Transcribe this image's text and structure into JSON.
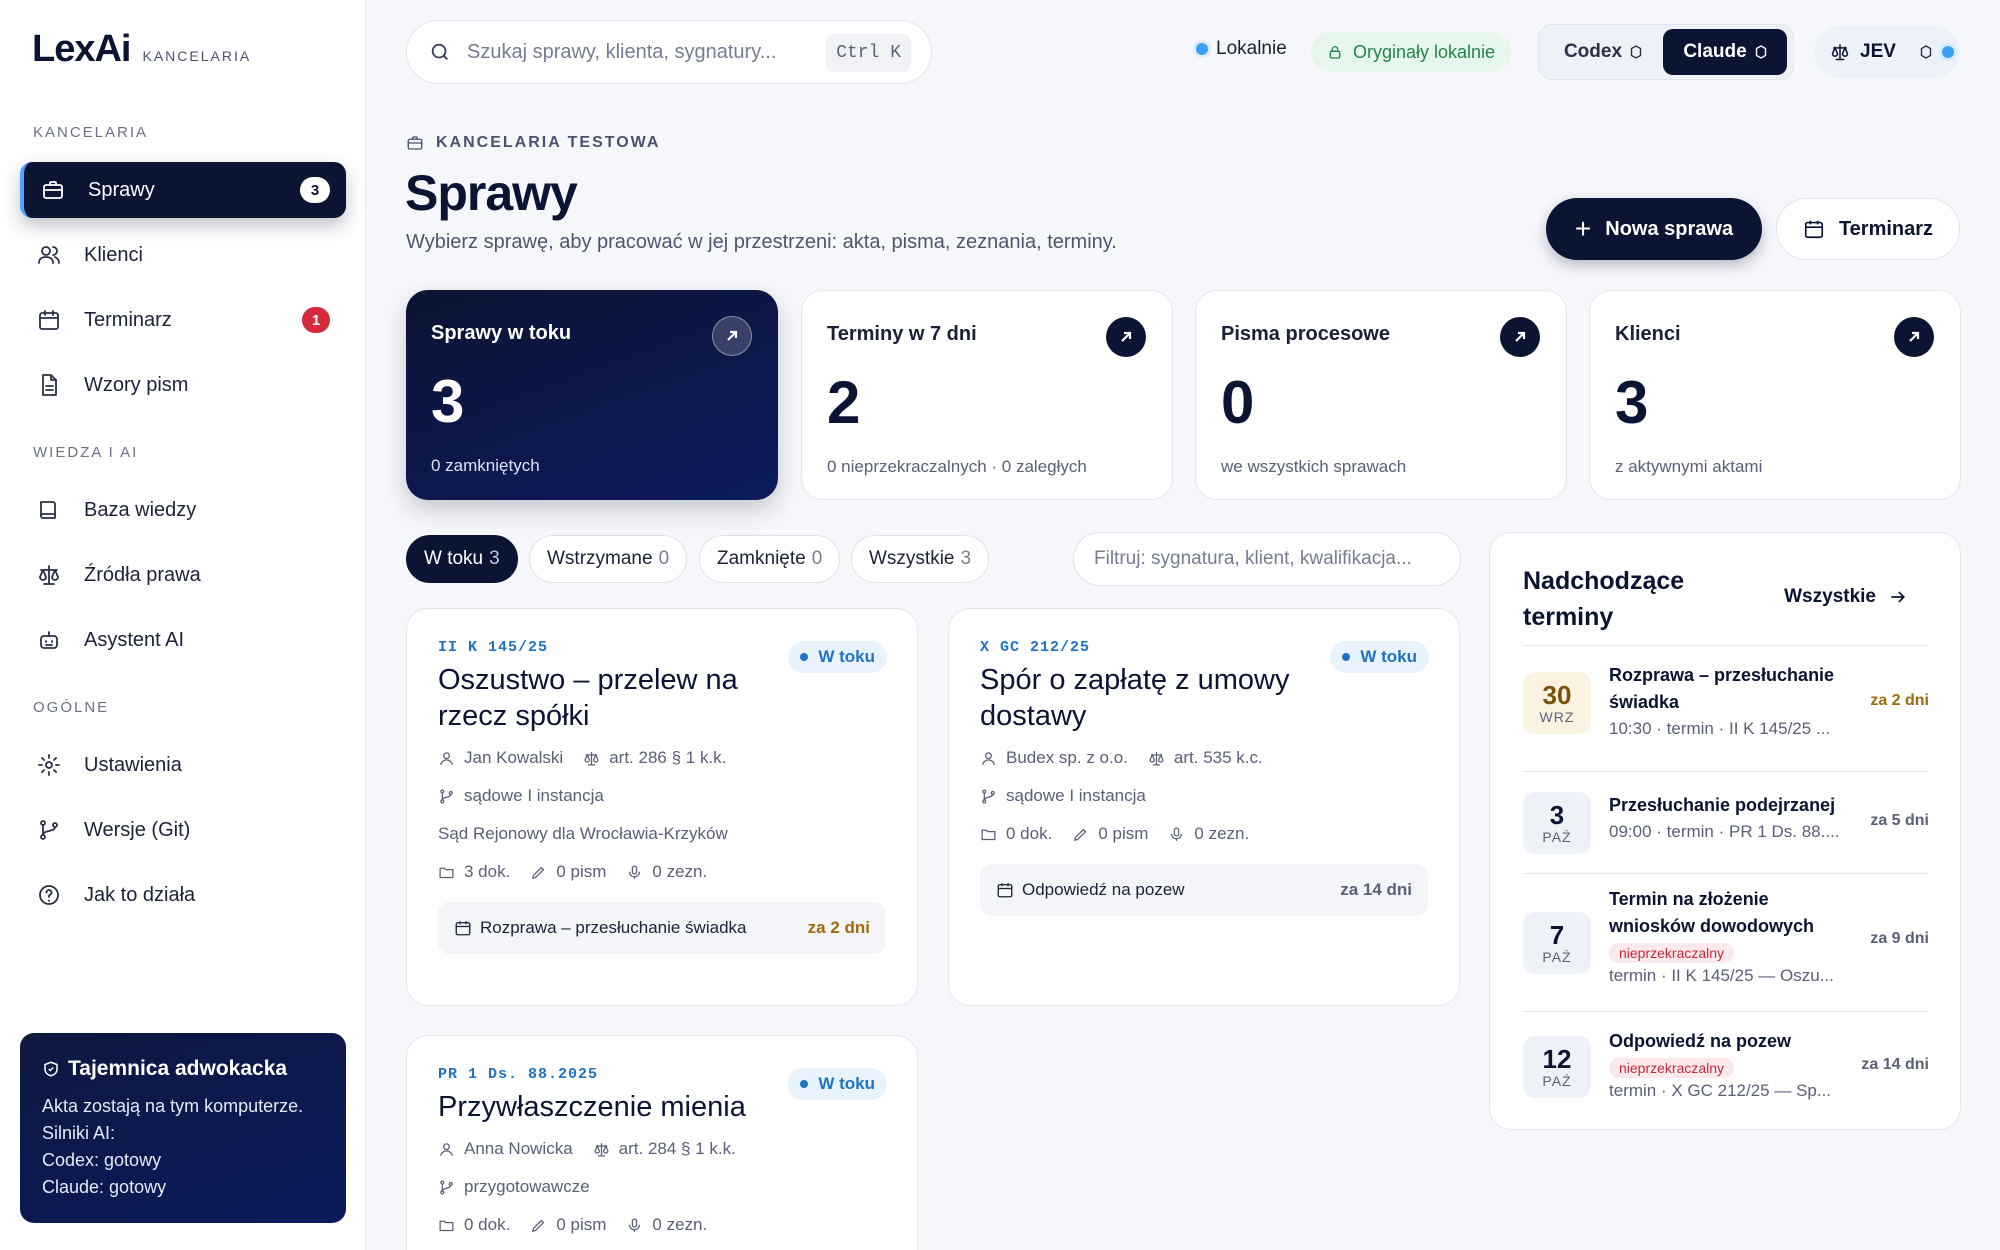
{
  "brand": {
    "name": "LexAi",
    "subtitle": "KANCELARIA"
  },
  "sidebar": {
    "sections": [
      {
        "label": "KANCELARIA"
      },
      {
        "label": "WIEDZA I AI"
      },
      {
        "label": "OGÓLNE"
      }
    ],
    "items": [
      {
        "label": "Sprawy",
        "icon": "briefcase-icon",
        "badge": "3",
        "active": true
      },
      {
        "label": "Klienci",
        "icon": "users-icon"
      },
      {
        "label": "Terminarz",
        "icon": "calendar-icon",
        "badge": "1"
      },
      {
        "label": "Wzory pism",
        "icon": "document-icon"
      },
      {
        "label": "Baza wiedzy",
        "icon": "book-icon"
      },
      {
        "label": "Źródła prawa",
        "icon": "scale-icon"
      },
      {
        "label": "Asystent AI",
        "icon": "robot-icon"
      },
      {
        "label": "Ustawienia",
        "icon": "gear-icon"
      },
      {
        "label": "Wersje (Git)",
        "icon": "git-branch-icon"
      },
      {
        "label": "Jak to działa",
        "icon": "help-icon"
      }
    ],
    "secret": {
      "title": "Tajemnica adwokacka",
      "lines": [
        "Akta zostają na tym komputerze.",
        "Silniki AI:",
        "Codex: gotowy",
        "Claude: gotowy"
      ]
    }
  },
  "topbar": {
    "search_placeholder": "Szukaj sprawy, klienta, sygnatury...",
    "shortcut": "Ctrl K",
    "status_local": "Lokalnie",
    "status_originals": "Oryginały lokalnie",
    "engines": {
      "codex": "Codex",
      "claude": "Claude",
      "selected": "Claude"
    },
    "user": "JEV"
  },
  "header": {
    "crumb": "KANCELARIA TESTOWA",
    "title": "Sprawy",
    "subtitle": "Wybierz sprawę, aby pracować w jej przestrzeni: akta, pisma, zeznania, terminy.",
    "new_case": "Nowa sprawa",
    "calendar": "Terminarz"
  },
  "stats": [
    {
      "label": "Sprawy w toku",
      "value": "3",
      "note": "0 zamkniętych"
    },
    {
      "label": "Terminy w 7 dni",
      "value": "2",
      "note": "0 nieprzekraczalnych · 0 zaległych"
    },
    {
      "label": "Pisma procesowe",
      "value": "0",
      "note": "we wszystkich sprawach"
    },
    {
      "label": "Klienci",
      "value": "3",
      "note": "z aktywnymi aktami"
    }
  ],
  "filters": {
    "tabs": [
      {
        "label": "W toku",
        "count": "3"
      },
      {
        "label": "Wstrzymane",
        "count": "0"
      },
      {
        "label": "Zamknięte",
        "count": "0"
      },
      {
        "label": "Wszystkie",
        "count": "3"
      }
    ],
    "active": "W toku",
    "placeholder": "Filtruj: sygnatura, klient, kwalifikacja..."
  },
  "cases": [
    {
      "signature": "II K 145/25",
      "title": "Oszustwo – przelew na rzecz spółki",
      "status": "W toku",
      "client": "Jan Kowalski",
      "article": "art. 286 § 1 k.k.",
      "stage": "sądowe I instancja",
      "court": "Sąd Rejonowy dla Wrocławia-Krzyków",
      "docs": "3 dok.",
      "letters": "0 pism",
      "testimonies": "0 zezn.",
      "event": "Rozprawa – przesłuchanie świadka",
      "event_when": "za 2 dni"
    },
    {
      "signature": "X GC 212/25",
      "title": "Spór o zapłatę z umowy dostawy",
      "status": "W toku",
      "client": "Budex sp. z o.o.",
      "article": "art. 535 k.c.",
      "stage": "sądowe I instancja",
      "docs": "0 dok.",
      "letters": "0 pism",
      "testimonies": "0 zezn.",
      "event": "Odpowiedź na pozew",
      "event_when": "za 14 dni"
    },
    {
      "signature": "PR 1 Ds. 88.2025",
      "title": "Przywłaszczenie mienia",
      "status": "W toku",
      "client": "Anna Nowicka",
      "article": "art. 284 § 1 k.k.",
      "stage": "przygotowawcze",
      "docs": "0 dok.",
      "letters": "0 pism",
      "testimonies": "0 zezn."
    }
  ],
  "upcoming": {
    "title": "Nadchodzące terminy",
    "all": "Wszystkie",
    "items": [
      {
        "day": "30",
        "month": "WRZ",
        "name": "Rozprawa – przesłuchanie świadka",
        "sub": "10:30 · termin · II K 145/25 ...",
        "when": "za 2 dni"
      },
      {
        "day": "3",
        "month": "PAŹ",
        "name": "Przesłuchanie podejrzanej",
        "sub": "09:00 · termin · PR 1 Ds. 88....",
        "when": "za 5 dni"
      },
      {
        "day": "7",
        "month": "PAŹ",
        "name": "Termin na złożenie wniosków dowodowych",
        "tag": "nieprzekraczalny",
        "sub": "termin · II K 145/25 — Oszu...",
        "when": "za 9 dni"
      },
      {
        "day": "12",
        "month": "PAŹ",
        "name": "Odpowiedź na pozew",
        "tag": "nieprzekraczalny",
        "sub": "termin · X GC 212/25 — Sp...",
        "when": "za 14 dni"
      }
    ]
  }
}
